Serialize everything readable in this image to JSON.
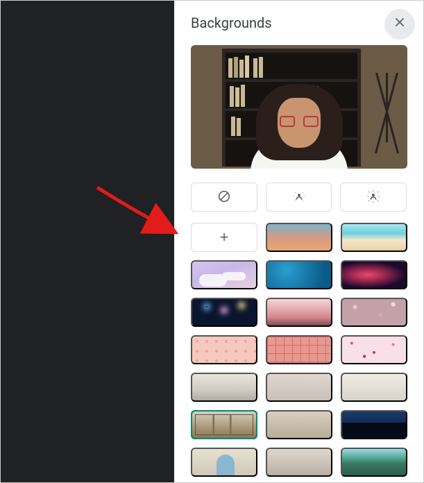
{
  "panel": {
    "title": "Backgrounds"
  },
  "effects": {
    "none": "no-background-effect",
    "blur_light": "slightly-blur-background",
    "blur_strong": "blur-background"
  },
  "actions": {
    "add_label": "+"
  },
  "thumbnails": [
    {
      "name": "sunset-gradient",
      "cls": "bg-sunset",
      "selected": false
    },
    {
      "name": "beach",
      "cls": "bg-beach",
      "selected": false
    },
    {
      "name": "purple-clouds",
      "cls": "bg-clouds",
      "selected": false
    },
    {
      "name": "blue-water",
      "cls": "bg-water",
      "selected": false
    },
    {
      "name": "nebula",
      "cls": "bg-nebula",
      "selected": false
    },
    {
      "name": "fireworks",
      "cls": "bg-fireworks",
      "selected": false
    },
    {
      "name": "cherry-blossom",
      "cls": "bg-cherry",
      "selected": false
    },
    {
      "name": "cherry-blossom-2",
      "cls": "bg-cherry2",
      "selected": false
    },
    {
      "name": "pink-dots",
      "cls": "bg-pinkdots",
      "selected": false
    },
    {
      "name": "pink-tiles",
      "cls": "bg-pinktile",
      "selected": false
    },
    {
      "name": "pink-confetti",
      "cls": "bg-confetti",
      "selected": false
    },
    {
      "name": "living-room-1",
      "cls": "bg-room1",
      "selected": false
    },
    {
      "name": "living-room-2",
      "cls": "bg-room2",
      "selected": false
    },
    {
      "name": "living-room-3",
      "cls": "bg-room3",
      "selected": false
    },
    {
      "name": "library-bookshelf",
      "cls": "bg-library",
      "selected": true
    },
    {
      "name": "office-shelves",
      "cls": "bg-office",
      "selected": false
    },
    {
      "name": "night-city-window",
      "cls": "bg-nightcity",
      "selected": false
    },
    {
      "name": "arched-doorway",
      "cls": "bg-arch",
      "selected": false
    },
    {
      "name": "loft-interior",
      "cls": "bg-loft",
      "selected": false
    },
    {
      "name": "tropical-lagoon",
      "cls": "bg-lagoon",
      "selected": false
    }
  ]
}
